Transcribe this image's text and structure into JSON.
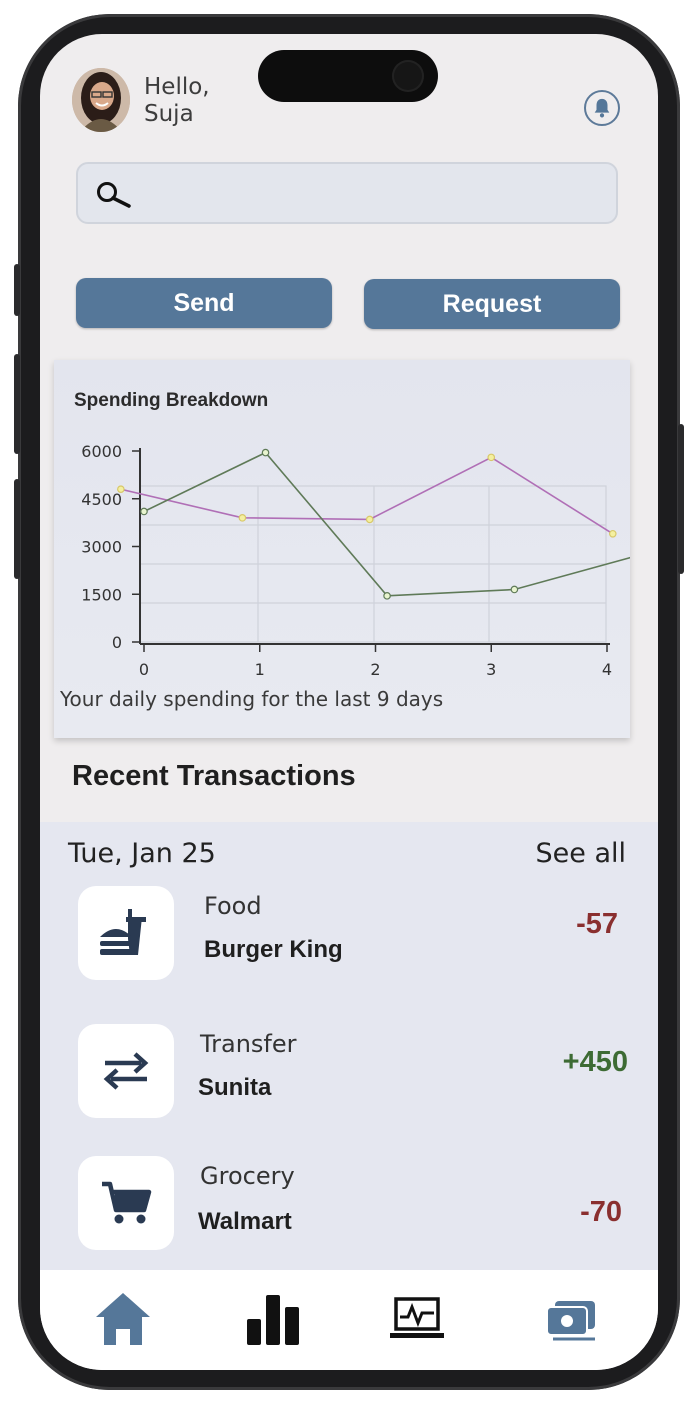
{
  "header": {
    "greeting": "Hello,",
    "user_name": "Suja"
  },
  "search": {
    "placeholder": ""
  },
  "actions": {
    "send_label": "Send",
    "request_label": "Request"
  },
  "spending": {
    "title": "Spending Breakdown",
    "subtitle": "Your daily spending for the last 9 days"
  },
  "chart_data": {
    "type": "line",
    "title": "Spending Breakdown",
    "xlabel": "",
    "ylabel": "",
    "x_ticks": [
      "0",
      "1",
      "2",
      "3",
      "4"
    ],
    "y_ticks": [
      "6000",
      "4500",
      "3000",
      "1500",
      "0"
    ],
    "xlim": [
      0,
      4
    ],
    "ylim": [
      0,
      6000
    ],
    "grid": true,
    "series": [
      {
        "color": "#b06fb6",
        "x": [
          -0.2,
          0.85,
          1.95,
          3.0,
          4.05
        ],
        "y": [
          4800,
          3900,
          3850,
          5800,
          3400
        ]
      },
      {
        "color": "#5f7a58",
        "x": [
          0.0,
          1.05,
          2.1,
          3.2,
          4.25
        ],
        "y": [
          4100,
          5950,
          1450,
          1650,
          2700
        ]
      }
    ]
  },
  "recent": {
    "title": "Recent Transactions",
    "date": "Tue, Jan 25",
    "see_all": "See all",
    "items": [
      {
        "category": "Food",
        "merchant": "Burger King",
        "amount": "-57",
        "icon": "burger-drink-icon",
        "color": "#8a2f2f"
      },
      {
        "category": "Transfer",
        "merchant": "Sunita",
        "amount": "+450",
        "icon": "transfer-arrows-icon",
        "color": "#3d6b34"
      },
      {
        "category": "Grocery",
        "merchant": "Walmart",
        "amount": "-70",
        "icon": "shopping-cart-icon",
        "color": "#8a2f2f"
      }
    ]
  },
  "nav": {
    "items": [
      {
        "name": "home-icon",
        "color": "#557799"
      },
      {
        "name": "bar-chart-icon",
        "color": "#111111"
      },
      {
        "name": "activity-monitor-icon",
        "color": "#111111"
      },
      {
        "name": "money-icon",
        "color": "#557799"
      }
    ]
  }
}
